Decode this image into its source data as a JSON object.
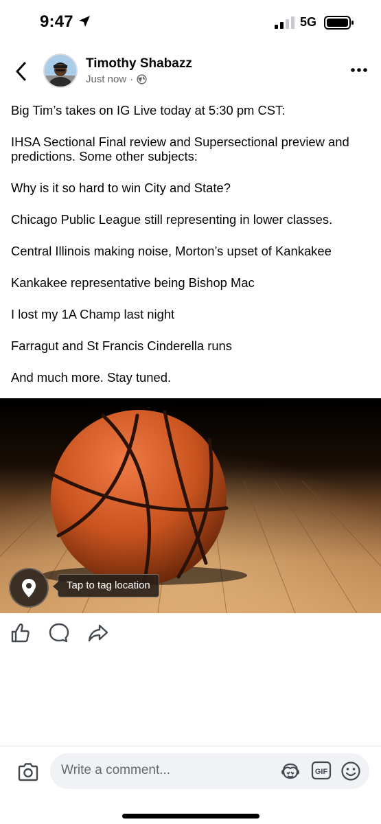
{
  "status_bar": {
    "time": "9:47",
    "network": "5G",
    "location_icon": "location-arrow-icon",
    "signal_icon": "cell-signal-icon",
    "battery_icon": "battery-icon"
  },
  "post": {
    "author": "Timothy Shabazz",
    "timestamp": "Just now",
    "separator": "·",
    "audience_icon": "globe-icon",
    "paragraphs": [
      "Big Tim’s takes on IG Live today at 5:30 pm CST:",
      "IHSA Sectional Final review and Supersectional preview and predictions. Some other subjects:",
      "Why is it so hard to win City and State?",
      "Chicago Public League still representing in lower classes.",
      "Central Illinois making noise, Morton’s upset of Kankakee",
      "Kankakee representative being Bishop Mac",
      "I lost my 1A Champ last night",
      "Farragut and St Francis Cinderella runs",
      "And much more. Stay tuned."
    ],
    "photo": {
      "subject_icon": "basketball-photo",
      "tag_location_label": "Tap to tag location",
      "tag_icon": "map-pin-icon"
    },
    "actions": [
      "like-icon",
      "comment-icon",
      "share-icon"
    ]
  },
  "comment_bar": {
    "placeholder": "Write a comment...",
    "icons": [
      "camera-icon",
      "avatar-sticker-icon",
      "gif-icon",
      "emoji-icon"
    ],
    "gif_label": "GIF"
  },
  "colors": {
    "text_primary": "#050505",
    "text_secondary": "#65676b",
    "input_bg": "#f0f2f5",
    "tooltip_bg": "#28201a"
  }
}
